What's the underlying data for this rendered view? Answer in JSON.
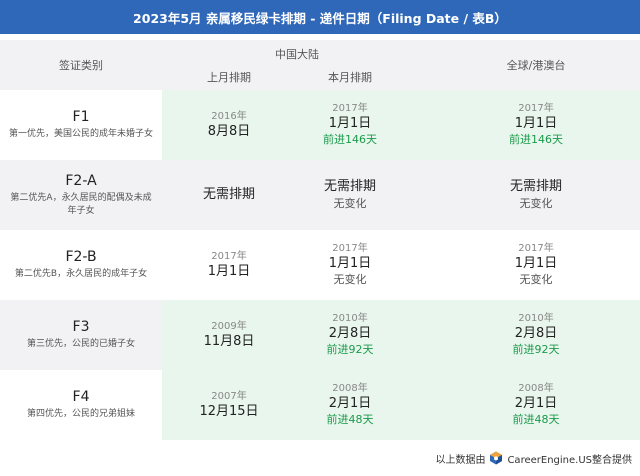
{
  "title": "2023年5月 亲属移民绿卡排期 - 递件日期（Filing Date / 表B）",
  "header": {
    "category": "签证类别",
    "mainland": "中国大陆",
    "last_month": "上月排期",
    "this_month": "本月排期",
    "global": "全球/港澳台"
  },
  "rows": [
    {
      "code": "F1",
      "desc": "第一优先，美国公民的成年未婚子女",
      "last": {
        "year": "2016年",
        "md": "8月8日"
      },
      "this": {
        "year": "2017年",
        "md": "1月1日",
        "change": "前进146天"
      },
      "global": {
        "year": "2017年",
        "md": "1月1日",
        "change": "前进146天"
      }
    },
    {
      "code": "F2-A",
      "desc": "第二优先A，永久居民的配偶及未成年子女",
      "last": {
        "text": "无需排期"
      },
      "this": {
        "text": "无需排期",
        "change": "无变化"
      },
      "global": {
        "text": "无需排期",
        "change": "无变化"
      }
    },
    {
      "code": "F2-B",
      "desc": "第二优先B，永久居民的成年子女",
      "last": {
        "year": "2017年",
        "md": "1月1日"
      },
      "this": {
        "year": "2017年",
        "md": "1月1日",
        "change": "无变化"
      },
      "global": {
        "year": "2017年",
        "md": "1月1日",
        "change": "无变化"
      }
    },
    {
      "code": "F3",
      "desc": "第三优先，公民的已婚子女",
      "last": {
        "year": "2009年",
        "md": "11月8日"
      },
      "this": {
        "year": "2010年",
        "md": "2月8日",
        "change": "前进92天"
      },
      "global": {
        "year": "2010年",
        "md": "2月8日",
        "change": "前进92天"
      }
    },
    {
      "code": "F4",
      "desc": "第四优先，公民的兄弟姐妹",
      "last": {
        "year": "2007年",
        "md": "12月15日"
      },
      "this": {
        "year": "2008年",
        "md": "2月1日",
        "change": "前进48天"
      },
      "global": {
        "year": "2008年",
        "md": "2月1日",
        "change": "前进48天"
      }
    }
  ],
  "footer": {
    "prefix": "以上数据由",
    "brand": "CareerEngine.US整合提供",
    "logo_icon": "careerengine-logo-icon"
  },
  "colors": {
    "banner": "#2f68b9",
    "advance": "#1a9a4a",
    "green_bg": "#e9f6ed",
    "grey_bg": "#f2f2f4"
  }
}
